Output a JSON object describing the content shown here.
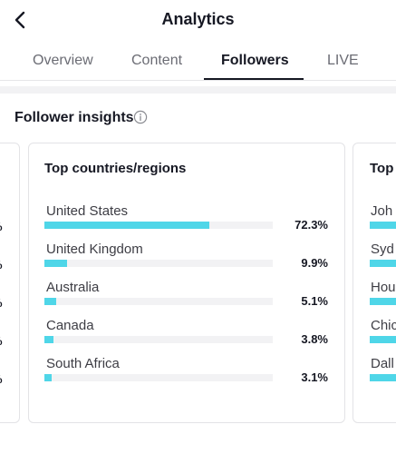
{
  "header": {
    "title": "Analytics"
  },
  "tabs": [
    {
      "label": "Overview",
      "active": false
    },
    {
      "label": "Content",
      "active": false
    },
    {
      "label": "Followers",
      "active": true
    },
    {
      "label": "LIVE",
      "active": false
    }
  ],
  "section": {
    "title": "Follower insights"
  },
  "card_main": {
    "title": "Top countries/regions",
    "rows": [
      {
        "label": "United States",
        "percent": "72.3%",
        "value": 0.723
      },
      {
        "label": "United Kingdom",
        "percent": "9.9%",
        "value": 0.099
      },
      {
        "label": "Australia",
        "percent": "5.1%",
        "value": 0.051
      },
      {
        "label": "Canada",
        "percent": "3.8%",
        "value": 0.038
      },
      {
        "label": "South Africa",
        "percent": "3.1%",
        "value": 0.031
      }
    ]
  },
  "card_right": {
    "title": "Top",
    "rows": [
      {
        "label": "Joh"
      },
      {
        "label": "Syd"
      },
      {
        "label": "Hou"
      },
      {
        "label": "Chic"
      },
      {
        "label": "Dall"
      }
    ]
  },
  "card_left": {
    "percents": [
      "%",
      "%",
      "%",
      "%",
      "%"
    ]
  },
  "colors": {
    "accent": "#4fd6e8",
    "track": "#f2f2f4",
    "text": "#161823"
  },
  "icons": {
    "back": "chevron-left-icon",
    "info": "info-icon"
  }
}
